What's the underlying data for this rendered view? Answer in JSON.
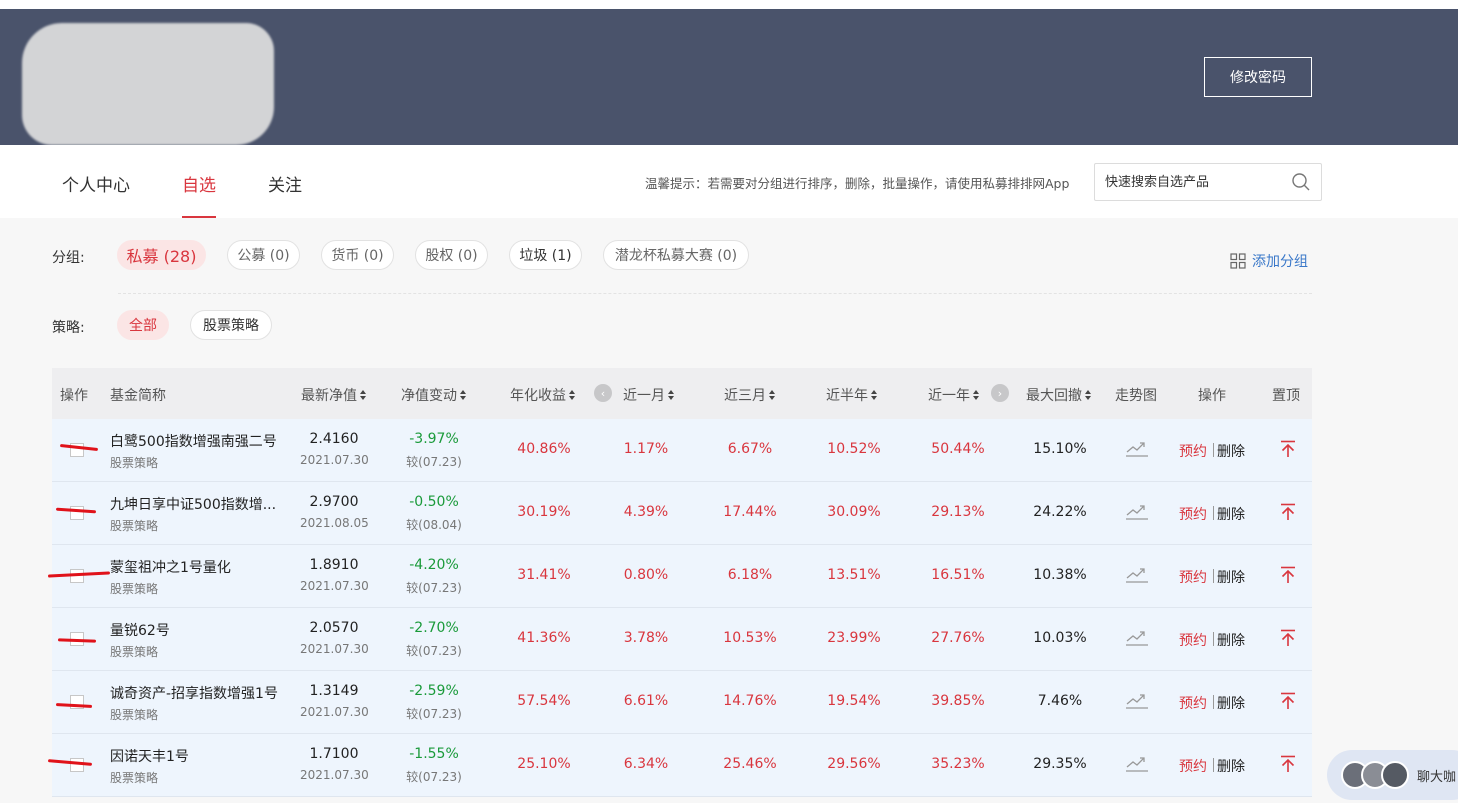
{
  "header": {
    "change_password": "修改密码"
  },
  "nav": {
    "tabs": [
      "个人中心",
      "自选",
      "关注"
    ],
    "active_tab": "自选",
    "tip": "温馨提示：若需要对分组进行排序，删除，批量操作，请使用私募排排网App",
    "search_placeholder": "快速搜索自选产品"
  },
  "groups": {
    "label": "分组:",
    "items": [
      "私募 (28)",
      "公募 (0)",
      "货币 (0)",
      "股权 (0)",
      "垃圾 (1)",
      "潜龙杯私募大赛 (0)"
    ],
    "add_label": "添加分组"
  },
  "strategy": {
    "label": "策略:",
    "items": [
      "全部",
      "股票策略"
    ]
  },
  "table": {
    "headers": {
      "op": "操作",
      "name": "基金简称",
      "nav": "最新净值",
      "chg": "净值变动",
      "annual": "年化收益",
      "m1": "近一月",
      "m3": "近三月",
      "m6": "近半年",
      "y1": "近一年",
      "dd": "最大回撤",
      "trend": "走势图",
      "action": "操作",
      "top": "置顶"
    },
    "book_label": "预约",
    "delete_label": "删除",
    "rows": [
      {
        "name": "白鹭500指数增强南强二号",
        "tag": "股票策略",
        "nav": "2.4160",
        "nav_date": "2021.07.30",
        "chg": "-3.97%",
        "chg_date": "较(07.23)",
        "annual": "40.86%",
        "m1": "1.17%",
        "m3": "6.67%",
        "m6": "10.52%",
        "y1": "50.44%",
        "dd": "15.10%"
      },
      {
        "name": "九坤日享中证500指数增...",
        "tag": "股票策略",
        "nav": "2.9700",
        "nav_date": "2021.08.05",
        "chg": "-0.50%",
        "chg_date": "较(08.04)",
        "annual": "30.19%",
        "m1": "4.39%",
        "m3": "17.44%",
        "m6": "30.09%",
        "y1": "29.13%",
        "dd": "24.22%"
      },
      {
        "name": "蒙玺祖冲之1号量化",
        "tag": "股票策略",
        "nav": "1.8910",
        "nav_date": "2021.07.30",
        "chg": "-4.20%",
        "chg_date": "较(07.23)",
        "annual": "31.41%",
        "m1": "0.80%",
        "m3": "6.18%",
        "m6": "13.51%",
        "y1": "16.51%",
        "dd": "10.38%"
      },
      {
        "name": "量锐62号",
        "tag": "股票策略",
        "nav": "2.0570",
        "nav_date": "2021.07.30",
        "chg": "-2.70%",
        "chg_date": "较(07.23)",
        "annual": "41.36%",
        "m1": "3.78%",
        "m3": "10.53%",
        "m6": "23.99%",
        "y1": "27.76%",
        "dd": "10.03%"
      },
      {
        "name": "诚奇资产-招享指数增强1号",
        "tag": "股票策略",
        "nav": "1.3149",
        "nav_date": "2021.07.30",
        "chg": "-2.59%",
        "chg_date": "较(07.23)",
        "annual": "57.54%",
        "m1": "6.61%",
        "m3": "14.76%",
        "m6": "19.54%",
        "y1": "39.85%",
        "dd": "7.46%"
      },
      {
        "name": "因诺天丰1号",
        "tag": "股票策略",
        "nav": "1.7100",
        "nav_date": "2021.07.30",
        "chg": "-1.55%",
        "chg_date": "较(07.23)",
        "annual": "25.10%",
        "m1": "6.34%",
        "m3": "25.46%",
        "m6": "29.56%",
        "y1": "35.23%",
        "dd": "29.35%"
      }
    ]
  },
  "chat": {
    "label": "聊大咖"
  },
  "colors": {
    "header_bg": "#4a536b",
    "accent_red": "#d9363e",
    "green": "#1a9a3a",
    "link_blue": "#3a78c9"
  }
}
